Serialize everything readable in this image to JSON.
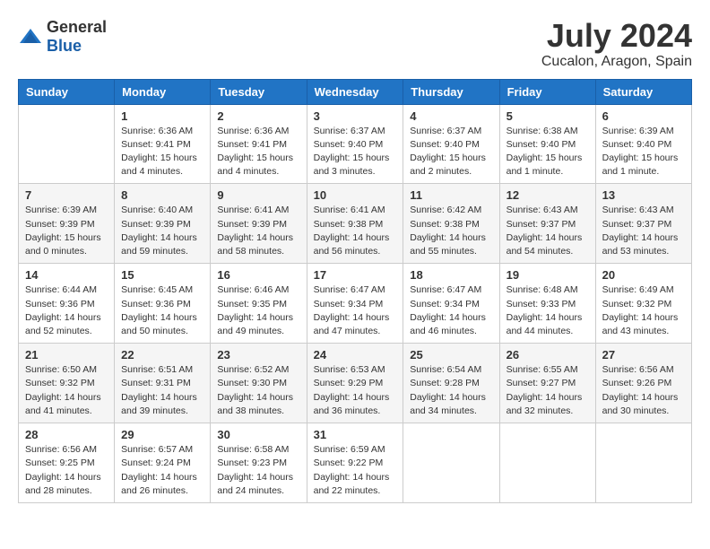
{
  "logo": {
    "general": "General",
    "blue": "Blue"
  },
  "title": {
    "month": "July 2024",
    "location": "Cucalon, Aragon, Spain"
  },
  "weekdays": [
    "Sunday",
    "Monday",
    "Tuesday",
    "Wednesday",
    "Thursday",
    "Friday",
    "Saturday"
  ],
  "weeks": [
    [
      {
        "day": "",
        "sunrise": "",
        "sunset": "",
        "daylight": ""
      },
      {
        "day": "1",
        "sunrise": "Sunrise: 6:36 AM",
        "sunset": "Sunset: 9:41 PM",
        "daylight": "Daylight: 15 hours and 4 minutes."
      },
      {
        "day": "2",
        "sunrise": "Sunrise: 6:36 AM",
        "sunset": "Sunset: 9:41 PM",
        "daylight": "Daylight: 15 hours and 4 minutes."
      },
      {
        "day": "3",
        "sunrise": "Sunrise: 6:37 AM",
        "sunset": "Sunset: 9:40 PM",
        "daylight": "Daylight: 15 hours and 3 minutes."
      },
      {
        "day": "4",
        "sunrise": "Sunrise: 6:37 AM",
        "sunset": "Sunset: 9:40 PM",
        "daylight": "Daylight: 15 hours and 2 minutes."
      },
      {
        "day": "5",
        "sunrise": "Sunrise: 6:38 AM",
        "sunset": "Sunset: 9:40 PM",
        "daylight": "Daylight: 15 hours and 1 minute."
      },
      {
        "day": "6",
        "sunrise": "Sunrise: 6:39 AM",
        "sunset": "Sunset: 9:40 PM",
        "daylight": "Daylight: 15 hours and 1 minute."
      }
    ],
    [
      {
        "day": "7",
        "sunrise": "Sunrise: 6:39 AM",
        "sunset": "Sunset: 9:39 PM",
        "daylight": "Daylight: 15 hours and 0 minutes."
      },
      {
        "day": "8",
        "sunrise": "Sunrise: 6:40 AM",
        "sunset": "Sunset: 9:39 PM",
        "daylight": "Daylight: 14 hours and 59 minutes."
      },
      {
        "day": "9",
        "sunrise": "Sunrise: 6:41 AM",
        "sunset": "Sunset: 9:39 PM",
        "daylight": "Daylight: 14 hours and 58 minutes."
      },
      {
        "day": "10",
        "sunrise": "Sunrise: 6:41 AM",
        "sunset": "Sunset: 9:38 PM",
        "daylight": "Daylight: 14 hours and 56 minutes."
      },
      {
        "day": "11",
        "sunrise": "Sunrise: 6:42 AM",
        "sunset": "Sunset: 9:38 PM",
        "daylight": "Daylight: 14 hours and 55 minutes."
      },
      {
        "day": "12",
        "sunrise": "Sunrise: 6:43 AM",
        "sunset": "Sunset: 9:37 PM",
        "daylight": "Daylight: 14 hours and 54 minutes."
      },
      {
        "day": "13",
        "sunrise": "Sunrise: 6:43 AM",
        "sunset": "Sunset: 9:37 PM",
        "daylight": "Daylight: 14 hours and 53 minutes."
      }
    ],
    [
      {
        "day": "14",
        "sunrise": "Sunrise: 6:44 AM",
        "sunset": "Sunset: 9:36 PM",
        "daylight": "Daylight: 14 hours and 52 minutes."
      },
      {
        "day": "15",
        "sunrise": "Sunrise: 6:45 AM",
        "sunset": "Sunset: 9:36 PM",
        "daylight": "Daylight: 14 hours and 50 minutes."
      },
      {
        "day": "16",
        "sunrise": "Sunrise: 6:46 AM",
        "sunset": "Sunset: 9:35 PM",
        "daylight": "Daylight: 14 hours and 49 minutes."
      },
      {
        "day": "17",
        "sunrise": "Sunrise: 6:47 AM",
        "sunset": "Sunset: 9:34 PM",
        "daylight": "Daylight: 14 hours and 47 minutes."
      },
      {
        "day": "18",
        "sunrise": "Sunrise: 6:47 AM",
        "sunset": "Sunset: 9:34 PM",
        "daylight": "Daylight: 14 hours and 46 minutes."
      },
      {
        "day": "19",
        "sunrise": "Sunrise: 6:48 AM",
        "sunset": "Sunset: 9:33 PM",
        "daylight": "Daylight: 14 hours and 44 minutes."
      },
      {
        "day": "20",
        "sunrise": "Sunrise: 6:49 AM",
        "sunset": "Sunset: 9:32 PM",
        "daylight": "Daylight: 14 hours and 43 minutes."
      }
    ],
    [
      {
        "day": "21",
        "sunrise": "Sunrise: 6:50 AM",
        "sunset": "Sunset: 9:32 PM",
        "daylight": "Daylight: 14 hours and 41 minutes."
      },
      {
        "day": "22",
        "sunrise": "Sunrise: 6:51 AM",
        "sunset": "Sunset: 9:31 PM",
        "daylight": "Daylight: 14 hours and 39 minutes."
      },
      {
        "day": "23",
        "sunrise": "Sunrise: 6:52 AM",
        "sunset": "Sunset: 9:30 PM",
        "daylight": "Daylight: 14 hours and 38 minutes."
      },
      {
        "day": "24",
        "sunrise": "Sunrise: 6:53 AM",
        "sunset": "Sunset: 9:29 PM",
        "daylight": "Daylight: 14 hours and 36 minutes."
      },
      {
        "day": "25",
        "sunrise": "Sunrise: 6:54 AM",
        "sunset": "Sunset: 9:28 PM",
        "daylight": "Daylight: 14 hours and 34 minutes."
      },
      {
        "day": "26",
        "sunrise": "Sunrise: 6:55 AM",
        "sunset": "Sunset: 9:27 PM",
        "daylight": "Daylight: 14 hours and 32 minutes."
      },
      {
        "day": "27",
        "sunrise": "Sunrise: 6:56 AM",
        "sunset": "Sunset: 9:26 PM",
        "daylight": "Daylight: 14 hours and 30 minutes."
      }
    ],
    [
      {
        "day": "28",
        "sunrise": "Sunrise: 6:56 AM",
        "sunset": "Sunset: 9:25 PM",
        "daylight": "Daylight: 14 hours and 28 minutes."
      },
      {
        "day": "29",
        "sunrise": "Sunrise: 6:57 AM",
        "sunset": "Sunset: 9:24 PM",
        "daylight": "Daylight: 14 hours and 26 minutes."
      },
      {
        "day": "30",
        "sunrise": "Sunrise: 6:58 AM",
        "sunset": "Sunset: 9:23 PM",
        "daylight": "Daylight: 14 hours and 24 minutes."
      },
      {
        "day": "31",
        "sunrise": "Sunrise: 6:59 AM",
        "sunset": "Sunset: 9:22 PM",
        "daylight": "Daylight: 14 hours and 22 minutes."
      },
      {
        "day": "",
        "sunrise": "",
        "sunset": "",
        "daylight": ""
      },
      {
        "day": "",
        "sunrise": "",
        "sunset": "",
        "daylight": ""
      },
      {
        "day": "",
        "sunrise": "",
        "sunset": "",
        "daylight": ""
      }
    ]
  ]
}
